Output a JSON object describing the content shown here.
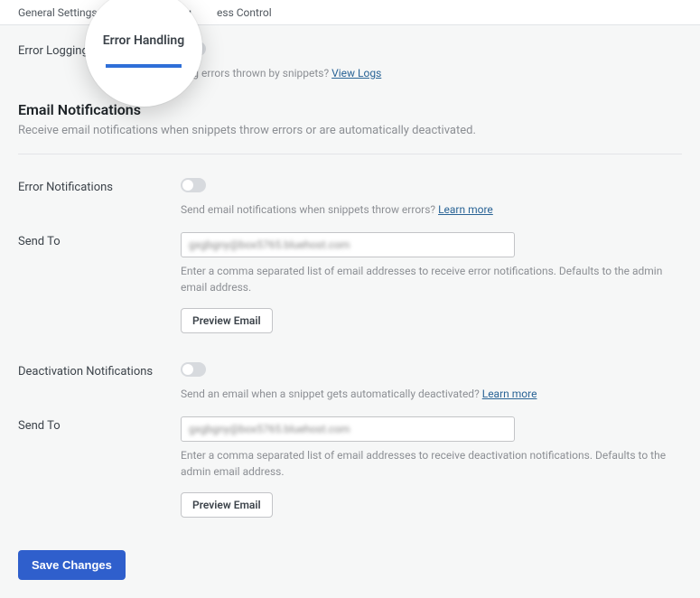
{
  "tabs": {
    "general": "General Settings",
    "error_handling": "Error Handling",
    "access_control": "ess Control"
  },
  "magnifier_label": "Error Handling",
  "error_logging": {
    "label": "Error Logging",
    "desc": "Log errors thrown by snippets?",
    "link": "View Logs"
  },
  "email_notifications": {
    "heading": "Email Notifications",
    "sub": "Receive email notifications when snippets throw errors or are automatically deactivated."
  },
  "error_notifications": {
    "label": "Error Notifications",
    "desc": "Send email notifications when snippets throw errors?",
    "link": "Learn more"
  },
  "send_to_1": {
    "label": "Send To",
    "value": "gxgbgny@box5765.bluehost.com",
    "help": "Enter a comma separated list of email addresses to receive error notifications. Defaults to the admin email address."
  },
  "preview_email_1": "Preview Email",
  "deactivation_notifications": {
    "label": "Deactivation Notifications",
    "desc": "Send an email when a snippet gets automatically deactivated?",
    "link": "Learn more"
  },
  "send_to_2": {
    "label": "Send To",
    "value": "gxgbgny@box5765.bluehost.com",
    "help": "Enter a comma separated list of email addresses to receive deactivation notifications. Defaults to the admin email address."
  },
  "preview_email_2": "Preview Email",
  "save_changes": "Save Changes"
}
